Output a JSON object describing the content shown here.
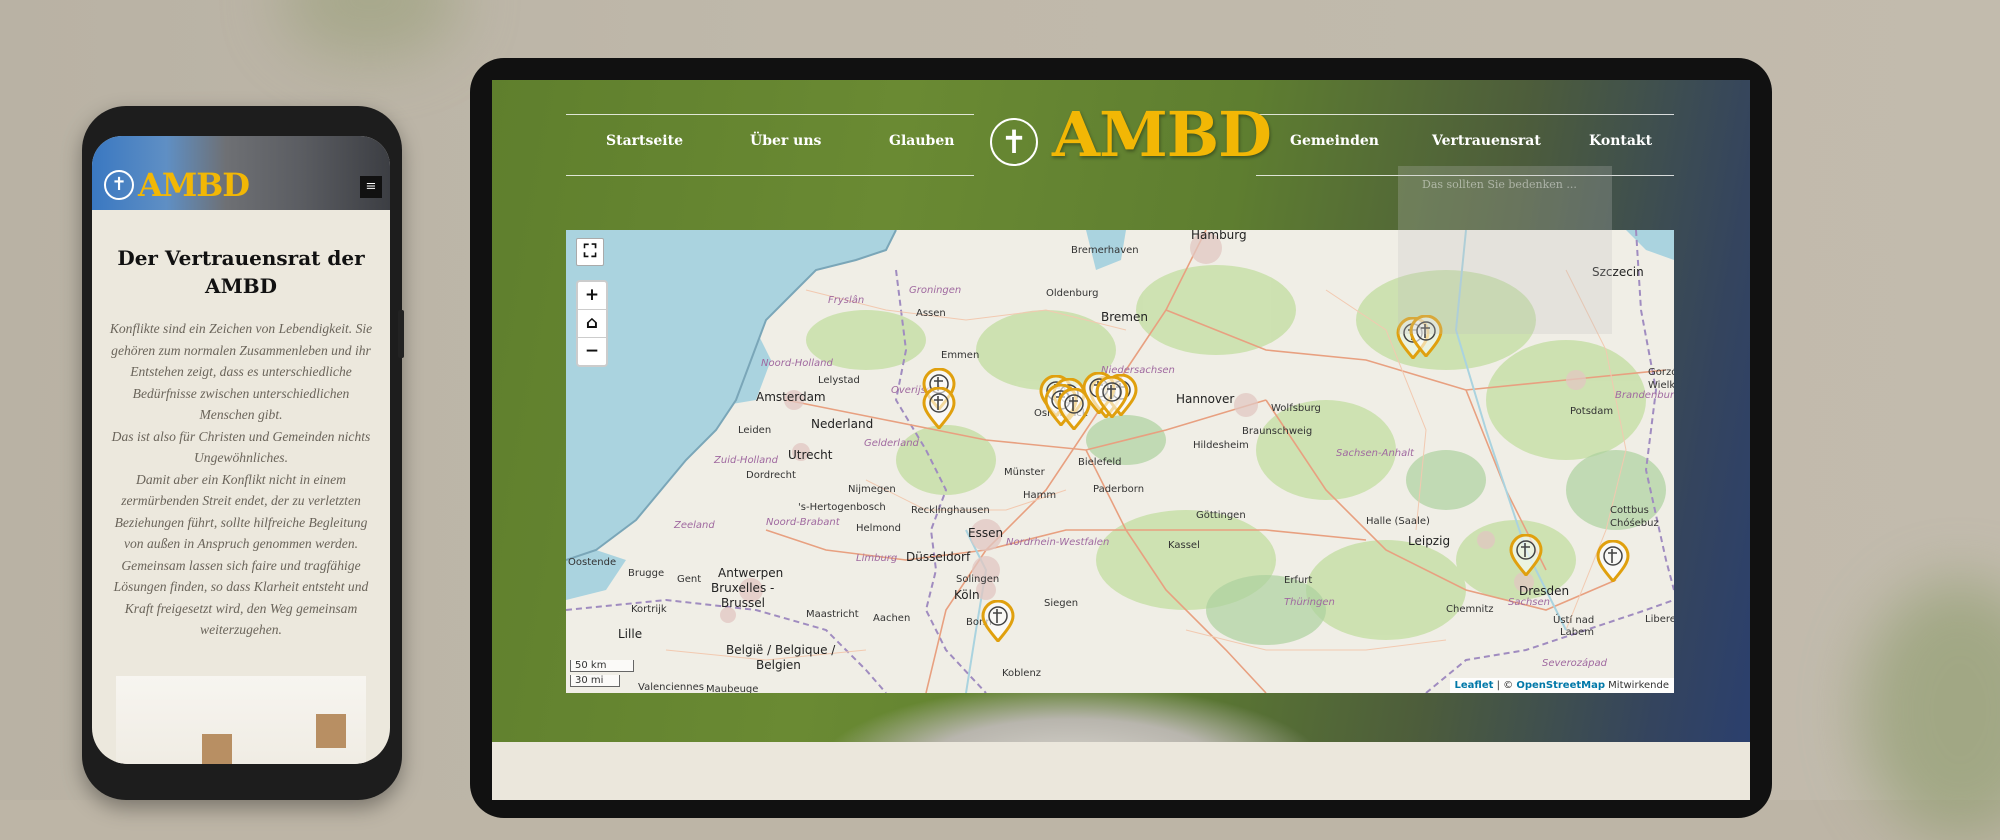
{
  "phone": {
    "brand": "AMBD",
    "menu_glyph": "≡",
    "title": "Der Vertrauensrat der AMBD",
    "paragraphs": [
      "Konflikte sind ein Zeichen von Lebendigkeit. Sie gehören zum normalen Zusammenleben und ihr Entstehen zeigt, dass es unterschiedliche Bedürfnisse zwischen unterschiedlichen Menschen gibt.",
      "Das ist also für Christen und Gemeinden nichts Ungewöhnliches.",
      "Damit aber ein Konflikt nicht in einem zermürbenden Streit endet, der zu verletzten Beziehungen führt, sollte hilfreiche Begleitung von außen in Anspruch genommen werden.",
      "Gemeinsam lassen sich faire und tragfähige Lösungen finden, so dass Klarheit entsteht und Kraft freigesetzt wird, den Weg gemeinsam weiterzugehen."
    ]
  },
  "site": {
    "brand": "AMBD",
    "nav_left": [
      "Startseite",
      "Über uns",
      "Glauben"
    ],
    "nav_right": [
      "Gemeinden",
      "Vertrauensrat",
      "Kontakt"
    ],
    "dropdown_hint": "Das sollten Sie bedenken ..."
  },
  "map": {
    "controls": {
      "fullscreen": "⛶",
      "zoom_in": "+",
      "home": "⌂",
      "zoom_out": "−"
    },
    "scale": {
      "km": "50 km",
      "mi": "30 mi"
    },
    "attribution": {
      "leaflet": "Leaflet",
      "sep": " | © ",
      "osm": "OpenStreetMap",
      "suffix": " Mitwirkende"
    },
    "cities": [
      {
        "name": "Hamburg",
        "cls": "big"
      },
      {
        "name": "Bremerhaven",
        "cls": ""
      },
      {
        "name": "Oldenburg",
        "cls": ""
      },
      {
        "name": "Bremen",
        "cls": "big"
      },
      {
        "name": "Szczecin",
        "cls": "big"
      },
      {
        "name": "Groningen",
        "cls": "reg"
      },
      {
        "name": "Fryslân",
        "cls": "reg"
      },
      {
        "name": "Assen",
        "cls": ""
      },
      {
        "name": "Emmen",
        "cls": ""
      },
      {
        "name": "Noord-Holland",
        "cls": "reg"
      },
      {
        "name": "Lelystad",
        "cls": ""
      },
      {
        "name": "Amsterdam",
        "cls": "big"
      },
      {
        "name": "Nederland",
        "cls": "big"
      },
      {
        "name": "Overijssel",
        "cls": "reg"
      },
      {
        "name": "Niedersachsen",
        "cls": "reg"
      },
      {
        "name": "Hannover",
        "cls": "big"
      },
      {
        "name": "Wolfsburg",
        "cls": ""
      },
      {
        "name": "Leiden",
        "cls": ""
      },
      {
        "name": "Utrecht",
        "cls": "big"
      },
      {
        "name": "Gelderland",
        "cls": "reg"
      },
      {
        "name": "Osnabrück",
        "cls": ""
      },
      {
        "name": "Braunschweig",
        "cls": ""
      },
      {
        "name": "Hildesheim",
        "cls": ""
      },
      {
        "name": "Zuid-Holland",
        "cls": "reg"
      },
      {
        "name": "Dordrecht",
        "cls": ""
      },
      {
        "name": "Nijmegen",
        "cls": ""
      },
      {
        "name": "Münster",
        "cls": ""
      },
      {
        "name": "Hamm",
        "cls": ""
      },
      {
        "name": "Paderborn",
        "cls": ""
      },
      {
        "name": "Bielefeld",
        "cls": ""
      },
      {
        "name": "Sachsen-Anhalt",
        "cls": "reg"
      },
      {
        "name": "Potsdam",
        "cls": ""
      },
      {
        "name": "Brandenburg",
        "cls": "reg"
      },
      {
        "name": "Gorzów",
        "cls": ""
      },
      {
        "name": "Wielkopolska",
        "cls": ""
      },
      {
        "name": "'s-Hertogenbosch",
        "cls": ""
      },
      {
        "name": "Recklinghausen",
        "cls": ""
      },
      {
        "name": "Zeeland",
        "cls": "reg"
      },
      {
        "name": "Noord-Brabant",
        "cls": "reg"
      },
      {
        "name": "Helmond",
        "cls": ""
      },
      {
        "name": "Essen",
        "cls": "big"
      },
      {
        "name": "Göttingen",
        "cls": ""
      },
      {
        "name": "Halle (Saale)",
        "cls": ""
      },
      {
        "name": "Cottbus",
        "cls": ""
      },
      {
        "name": "Chóśebuz",
        "cls": ""
      },
      {
        "name": "Nordrhein-Westfalen",
        "cls": "reg"
      },
      {
        "name": "Kassel",
        "cls": ""
      },
      {
        "name": "Leipzig",
        "cls": "big"
      },
      {
        "name": "Oostende",
        "cls": ""
      },
      {
        "name": "Limburg",
        "cls": "reg"
      },
      {
        "name": "Düsseldorf",
        "cls": "big"
      },
      {
        "name": "Brugge",
        "cls": ""
      },
      {
        "name": "Gent",
        "cls": ""
      },
      {
        "name": "Antwerpen",
        "cls": "big"
      },
      {
        "name": "Bruxelles -",
        "cls": "big"
      },
      {
        "name": "Brussel",
        "cls": "big"
      },
      {
        "name": "Solingen",
        "cls": ""
      },
      {
        "name": "Köln",
        "cls": "big"
      },
      {
        "name": "Thüringen",
        "cls": "reg"
      },
      {
        "name": "Dresden",
        "cls": "big"
      },
      {
        "name": "Sachsen",
        "cls": "reg"
      },
      {
        "name": "Kortrijk",
        "cls": ""
      },
      {
        "name": "Maastricht",
        "cls": ""
      },
      {
        "name": "Aachen",
        "cls": ""
      },
      {
        "name": "Siegen",
        "cls": ""
      },
      {
        "name": "Erfurt",
        "cls": ""
      },
      {
        "name": "Chemnitz",
        "cls": ""
      },
      {
        "name": "Lille",
        "cls": "big"
      },
      {
        "name": "België / Belgique /",
        "cls": "big"
      },
      {
        "name": "Belgien",
        "cls": "big"
      },
      {
        "name": "Bonn",
        "cls": ""
      },
      {
        "name": "Ústí nad",
        "cls": ""
      },
      {
        "name": "Labem",
        "cls": ""
      },
      {
        "name": "Koblenz",
        "cls": ""
      },
      {
        "name": "Severozápad",
        "cls": "reg"
      },
      {
        "name": "Liberec",
        "cls": ""
      },
      {
        "name": "Valenciennes",
        "cls": ""
      },
      {
        "name": "Maubeuge",
        "cls": ""
      }
    ]
  },
  "colors": {
    "brand_gold": "#f2b705",
    "pin_gold": "#e0a00e"
  }
}
